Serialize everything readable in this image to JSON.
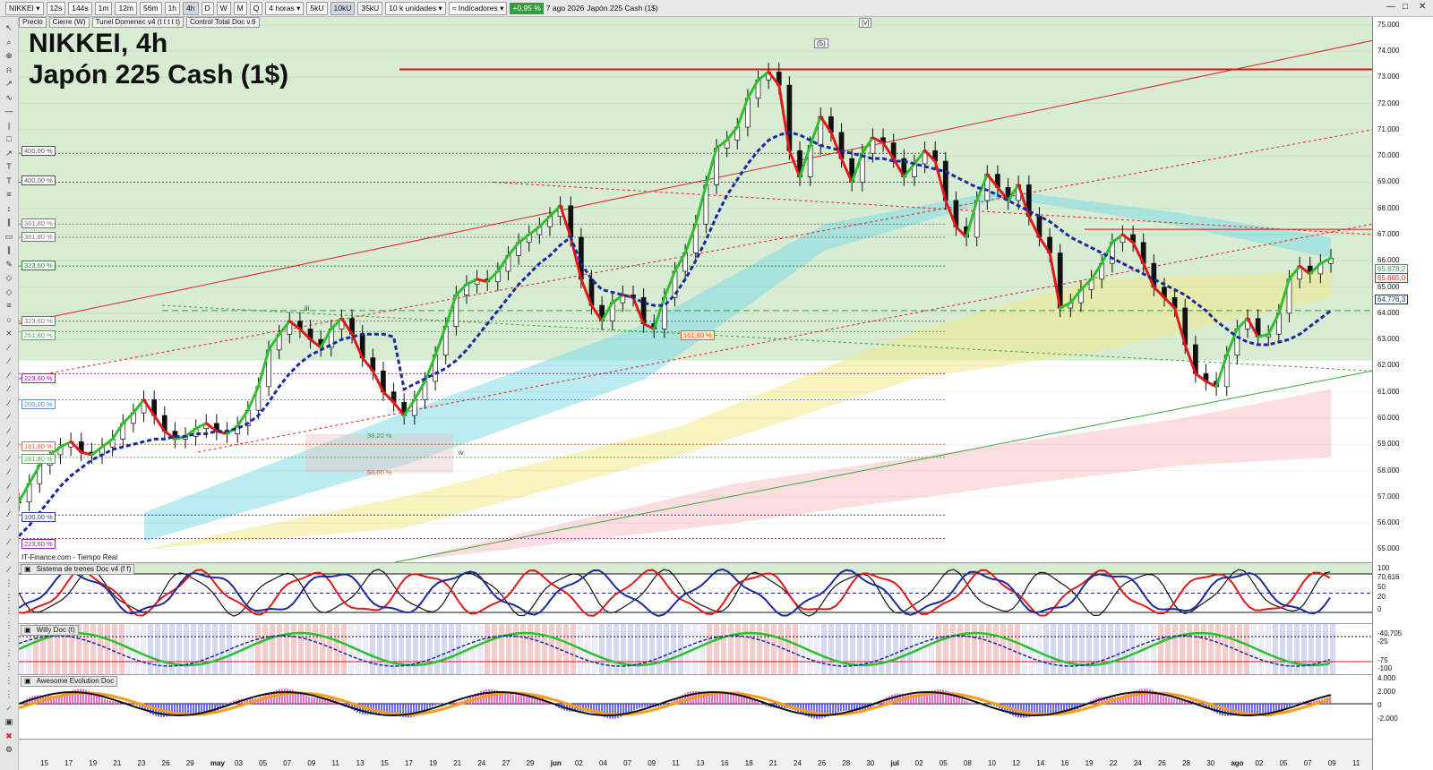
{
  "toolbar": {
    "symbol": "NIKKEI",
    "timeframes": [
      "12s",
      "144s",
      "1m",
      "12m",
      "56m",
      "1h",
      "4h",
      "D",
      "W",
      "M",
      "Q"
    ],
    "active_timeframe": "4h",
    "period": "4 horas",
    "volumes": [
      "5kU",
      "10kU",
      "35kU"
    ],
    "units": "10 k unidades",
    "indicators": "Indicadores",
    "change": "+0,95 %",
    "date": "7 ago 2026",
    "instrument": "Japón 225 Cash (1$)"
  },
  "legend": [
    "Precio",
    "Cierre (W)",
    "Tunel Domenec v4 (t t t t t)",
    "Control Total Doc v.6"
  ],
  "title_line1": "NIKKEI, 4h",
  "title_line2": "Japón 225 Cash (1$)",
  "source": "IT-Finance.com - Tiempo Real",
  "panels": {
    "trenes": "Sistema de trenes Doc v4 (f f)",
    "willy": "Willy Doc (t)",
    "awesome": "Awesome Evolution Doc"
  },
  "wave_labels": [
    "(5)",
    "[v]",
    "iii",
    "iv"
  ],
  "fib_labels": [
    {
      "text": "400,00 %",
      "color": "#555555"
    },
    {
      "text": "400,00 %",
      "color": "#555555"
    },
    {
      "text": "361,80 %",
      "color": "#777777"
    },
    {
      "text": "361,80 %",
      "color": "#777777"
    },
    {
      "text": "323,60 %",
      "color": "#2e7d32"
    },
    {
      "text": "323,60 %",
      "color": "#777777"
    },
    {
      "text": "261,80 %",
      "color": "#5aa55a"
    },
    {
      "text": "223,60 %",
      "color": "#8e24aa"
    },
    {
      "text": "200,00 %",
      "color": "#5a8fcf"
    },
    {
      "text": "161,80 %",
      "color": "#e0652b"
    },
    {
      "text": "261,80 %",
      "color": "#5aa55a"
    },
    {
      "text": "100,00 %",
      "color": "#2a3aa0"
    },
    {
      "text": "223,60 %",
      "color": "#8e24aa"
    },
    {
      "text": "161,80 %",
      "color": "#e0652b"
    },
    {
      "text": "38,20 %",
      "color": "#2e9e3e"
    },
    {
      "text": "50,00 %",
      "color": "#e0652b"
    }
  ],
  "price_boxes": [
    "65.878,2",
    "65.665,0",
    "64.776,3"
  ],
  "trenes_values": [
    "100",
    "70,616",
    "50",
    "20",
    "0"
  ],
  "willy_values": [
    "-40,705",
    "-25",
    "-75",
    "-100"
  ],
  "awesome_values": [
    "4.000",
    "2.000",
    "0",
    "-2.000"
  ],
  "chart_data": {
    "type": "line",
    "title": "NIKKEI, 4h",
    "subtitle": "Japón 225 Cash (1$)",
    "y_ticks": [
      75000,
      74000,
      73000,
      72000,
      71000,
      70000,
      69000,
      68000,
      67000,
      66000,
      65000,
      64000,
      63000,
      62000,
      61000,
      60000,
      59000,
      58000,
      57000,
      56000,
      55000
    ],
    "y_tick_labels": [
      "75.000",
      "74.000",
      "73.000",
      "72.000",
      "71.000",
      "70.000",
      "69.000",
      "68.000",
      "67.000",
      "66.000",
      "65.000",
      "64.000",
      "63.000",
      "62.000",
      "61.000",
      "60.000",
      "59.000",
      "58.000",
      "57.000",
      "56.000",
      "55.000"
    ],
    "ylim": [
      54500,
      75300
    ],
    "x_tick_labels": [
      "15",
      "17",
      "19",
      "21",
      "23",
      "26",
      "29",
      "may",
      "03",
      "05",
      "07",
      "09",
      "11",
      "13",
      "15",
      "17",
      "19",
      "21",
      "24",
      "27",
      "29",
      "jun",
      "02",
      "04",
      "07",
      "09",
      "11",
      "13",
      "16",
      "18",
      "21",
      "24",
      "26",
      "28",
      "30",
      "jul",
      "02",
      "05",
      "08",
      "10",
      "12",
      "14",
      "16",
      "19",
      "22",
      "24",
      "26",
      "28",
      "30",
      "ago",
      "02",
      "05",
      "07",
      "09",
      "11"
    ],
    "series": [
      {
        "values": [
          56800,
          57500,
          58200,
          58600,
          58900,
          59100,
          58700,
          58600,
          58900,
          59200,
          59800,
          60200,
          60700,
          60100,
          59500,
          59200,
          59300,
          59600,
          59800,
          59500,
          59400,
          59700,
          60300,
          61200,
          62600,
          63200,
          63700,
          63400,
          63000,
          62700,
          63400,
          63800,
          63200,
          62300,
          61800,
          61000,
          60600,
          60100,
          60700,
          61400,
          62400,
          63500,
          64700,
          65100,
          65300,
          65200,
          65600,
          66200,
          66700,
          67000,
          67300,
          67700,
          68100,
          66900,
          65300,
          64300,
          63700,
          64400,
          64700,
          64600,
          63600,
          63400,
          64600,
          65600,
          66300,
          67400,
          68900,
          70300,
          70600,
          71100,
          72200,
          72900,
          73200,
          72700,
          70200,
          69200,
          70400,
          71500,
          70900,
          69900,
          69000,
          70100,
          70700,
          70500,
          69900,
          69200,
          69700,
          70200,
          69800,
          68300,
          67300,
          66900,
          68300,
          69300,
          68800,
          68300,
          68900,
          67700,
          66900,
          66300,
          64200,
          64400,
          64900,
          65300,
          65900,
          66700,
          67000,
          66700,
          65900,
          65000,
          64600,
          64200,
          62800,
          61700,
          61400,
          61200,
          62400,
          63400,
          63800,
          63100,
          63200,
          64000,
          65300,
          65800,
          65500,
          65900,
          66100
        ]
      },
      {
        "values": [
          55500,
          55900,
          56400,
          56900,
          57400,
          57800,
          58100,
          58400,
          58600,
          58800,
          58900,
          59000,
          59100,
          59200,
          59200,
          59300,
          59300,
          59400,
          59400,
          59500,
          59500,
          59600,
          59800,
          60100,
          60600,
          61200,
          61700,
          62100,
          62400,
          62600,
          62800,
          63000,
          63100,
          63200,
          63200,
          63200,
          63100,
          61100,
          61300,
          61500,
          61700,
          61900,
          62200,
          62600,
          63100,
          63600,
          64100,
          64600,
          65100,
          65500,
          65900,
          66200,
          66600,
          66900,
          65900,
          65300,
          64900,
          64800,
          64700,
          64600,
          64400,
          64300,
          64300,
          64700,
          65300,
          66000,
          66800,
          67700,
          68500,
          69100,
          69700,
          70200,
          70600,
          70800,
          70900,
          70800,
          70600,
          70400,
          70300,
          70200,
          70100,
          70000,
          69900,
          69900,
          69800,
          69800,
          69700,
          69600,
          69500,
          69400,
          69200,
          69000,
          68800,
          68700,
          68500,
          68300,
          68100,
          67900,
          67700,
          67500,
          67200,
          66900,
          66700,
          66500,
          66300,
          66100,
          65900,
          65700,
          65500,
          65300,
          65100,
          64900,
          64700,
          64400,
          64100,
          63700,
          63400,
          63100,
          62900,
          62800,
          62800,
          62900,
          63000,
          63200,
          63500,
          63800,
          64100
        ]
      }
    ],
    "hlines": [
      73300,
      64100,
      63300
    ],
    "grid": true
  }
}
